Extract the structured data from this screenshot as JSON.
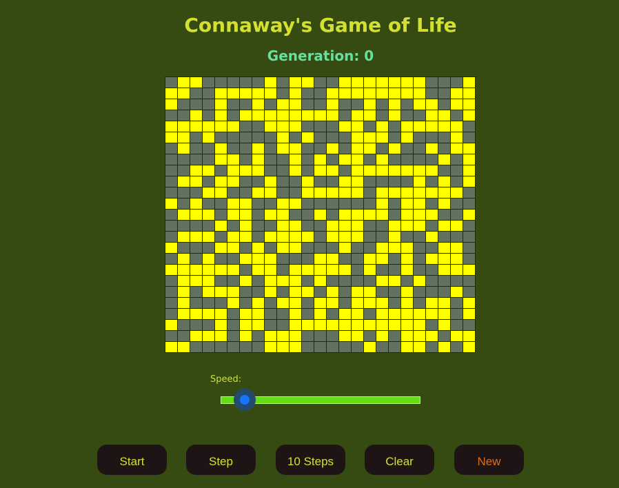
{
  "header": {
    "title": "Connaway's Game of Life",
    "generation_label": "Generation: 0"
  },
  "board": {
    "rows": 25,
    "cols": 25,
    "alive_color": "#ffff00",
    "dead_color": "#627060",
    "cells": [
      "0110000010110011111110001",
      "1100111110100111111110011",
      "1000100101100100101011011",
      "0010101111111101101001101",
      "1111110011100011010111110",
      "1101000001010001110100010",
      "0100100101100101101001011",
      "0000110100101011010000101",
      "0011011100101101111111001",
      "0110110010010011000010101",
      "0001100110011111011111110",
      "1010011001100000010110100",
      "0111011011001011110111001",
      "0000101001100111001110110",
      "0111011011110111001001000",
      "1000110101100010011100110",
      "0101001110001100110101110",
      "1111110110111110100100111",
      "0111001011101000011010000",
      "0101110010110101100100010",
      "0100010101101101110101101",
      "0111101100101011011111101",
      "1000101100111111111110100",
      "0011101011100011010111011",
      "1100000011100000100110101"
    ]
  },
  "controls": {
    "speed_label": "Speed:",
    "speed_value": 0.12
  },
  "buttons": {
    "start": "Start",
    "step": "Step",
    "ten_steps": "10 Steps",
    "clear": "Clear",
    "new": "New"
  }
}
